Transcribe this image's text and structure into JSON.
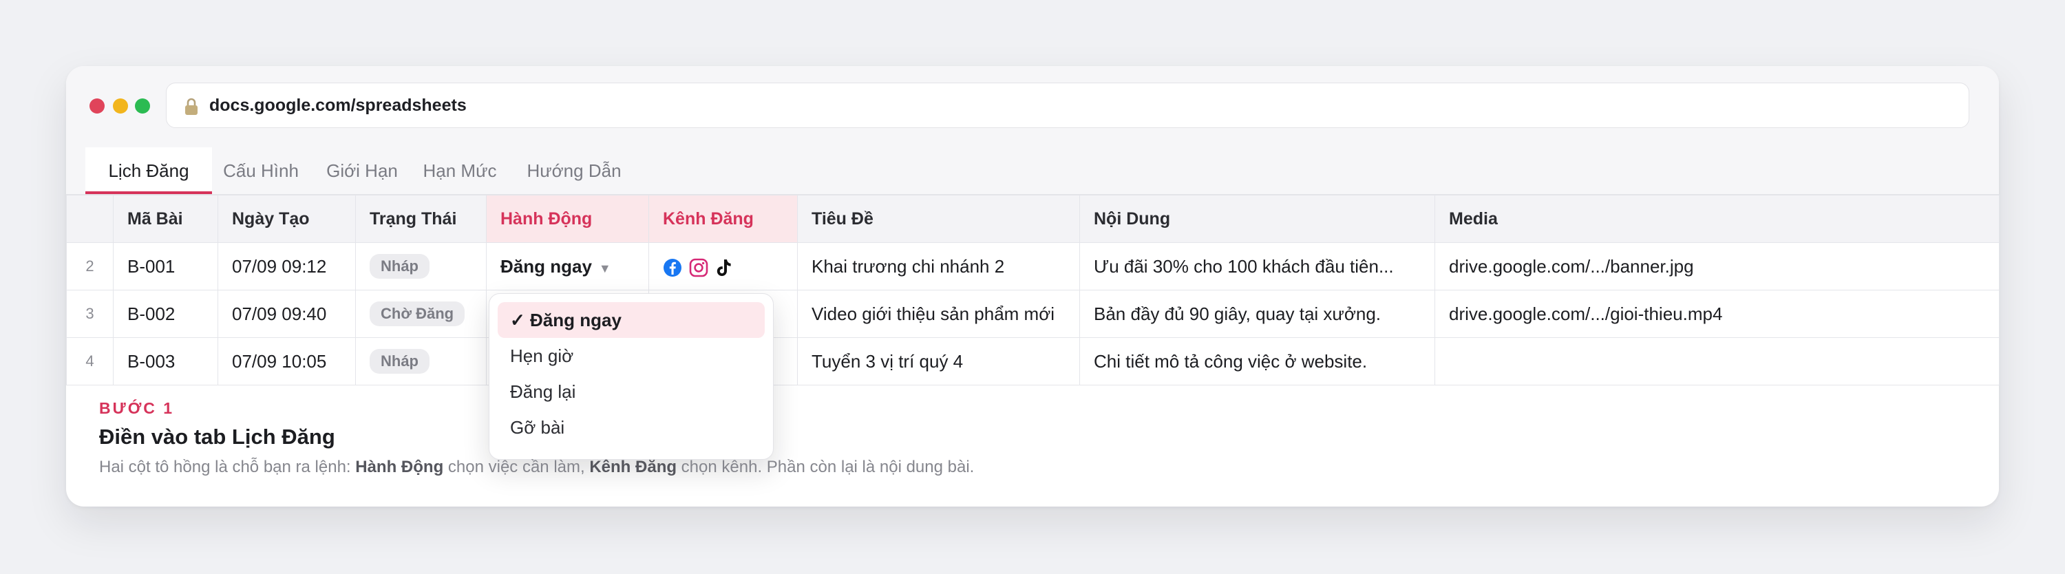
{
  "browser": {
    "url": "docs.google.com/spreadsheets"
  },
  "tabs": [
    {
      "label": "Lịch Đăng",
      "active": true
    },
    {
      "label": "Cấu Hình",
      "active": false
    },
    {
      "label": "Giới Hạn",
      "active": false
    },
    {
      "label": "Hạn Mức",
      "active": false
    },
    {
      "label": "Hướng Dẫn",
      "active": false
    }
  ],
  "sheet": {
    "headers": {
      "ma_bai": "Mã Bài",
      "ngay_tao": "Ngày Tạo",
      "trang_thai": "Trạng Thái",
      "hanh_dong": "Hành Động",
      "kenh_dang": "Kênh Đăng",
      "tieu_de": "Tiêu Đề",
      "noi_dung": "Nội Dung",
      "media": "Media"
    },
    "rows": [
      {
        "row_number": "2",
        "ma_bai": "B-001",
        "ngay_tao": "07/09 09:12",
        "trang_thai": "Nháp",
        "hanh_dong": "Đăng ngay",
        "kenh_dang_icons": [
          "facebook-icon",
          "instagram-icon",
          "tiktok-icon"
        ],
        "tieu_de": "Khai trương chi nhánh 2",
        "noi_dung": "Ưu đãi 30% cho 100 khách đầu tiên...",
        "media": "drive.google.com/.../banner.jpg"
      },
      {
        "row_number": "3",
        "ma_bai": "B-002",
        "ngay_tao": "07/09 09:40",
        "trang_thai": "Chờ Đăng",
        "tieu_de": "Video giới thiệu sản phẩm mới",
        "noi_dung": "Bản đầy đủ 90 giây, quay tại xưởng.",
        "media": "drive.google.com/.../gioi-thieu.mp4"
      },
      {
        "row_number": "4",
        "ma_bai": "B-003",
        "ngay_tao": "07/09 10:05",
        "trang_thai": "Nháp",
        "tieu_de": "Tuyển 3 vị trí quý 4",
        "noi_dung": "Chi tiết mô tả công việc ở website.",
        "media": ""
      }
    ]
  },
  "dropdown": {
    "options": [
      {
        "label": "✓ Đăng ngay",
        "selected": true
      },
      {
        "label": "Hẹn giờ",
        "selected": false
      },
      {
        "label": "Đăng lại",
        "selected": false
      },
      {
        "label": "Gỡ bài",
        "selected": false
      }
    ]
  },
  "step": {
    "label": "BƯỚC 1",
    "title": "Điền vào tab Lịch Đăng",
    "desc_part1": "Hai cột tô hồng là chỗ bạn ra lệnh: ",
    "desc_bold1": "Hành Động",
    "desc_part2": " chọn việc cần làm, ",
    "desc_bold2": "Kênh Đăng",
    "desc_part3": " chọn kênh. Phần còn lại là nội dung bài."
  },
  "colors": {
    "accent": "#d6335a",
    "pink_header_bg": "#fbe7ea",
    "selected_option_bg": "#fde8ec",
    "facebook": "#1877f2",
    "instagram": "#d62976"
  }
}
